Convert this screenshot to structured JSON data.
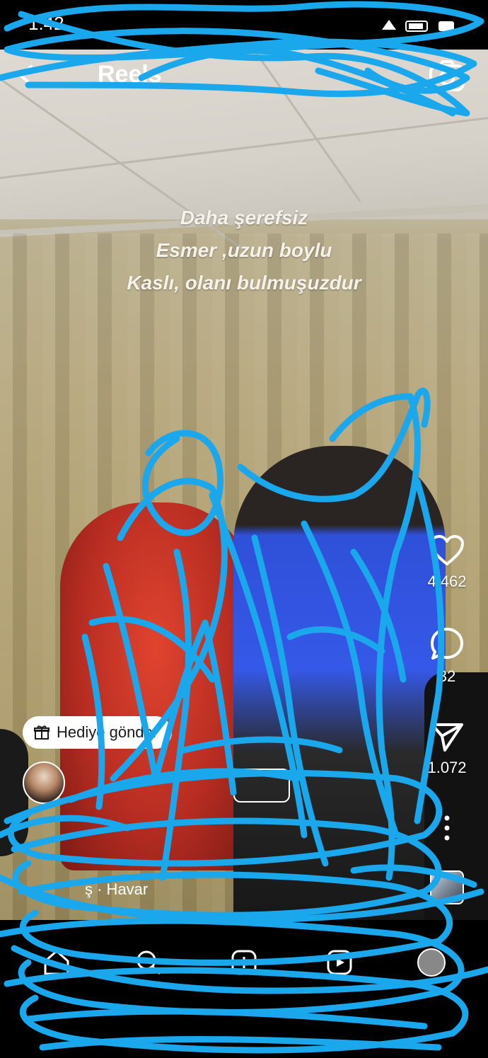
{
  "status_bar": {
    "time": "1:42"
  },
  "header": {
    "title": "Reels"
  },
  "video": {
    "caption_lines": [
      "Daha şerefsiz",
      "Esmer ,uzun boylu",
      "Kaslı, olanı bulmuşuzdur"
    ]
  },
  "actions": {
    "likes": "4.462",
    "comments": "32",
    "shares": "1.072"
  },
  "gift": {
    "label": "Hediye gönder"
  },
  "audio": {
    "text": "ş · Havar"
  },
  "colors": {
    "scribble": "#1aa7ec",
    "background": "#000000",
    "text": "#ffffff"
  },
  "icons": [
    "back-arrow-icon",
    "camera-icon",
    "heart-icon",
    "comment-icon",
    "send-icon",
    "more-icon",
    "gift-icon",
    "audio-thumbnail"
  ]
}
